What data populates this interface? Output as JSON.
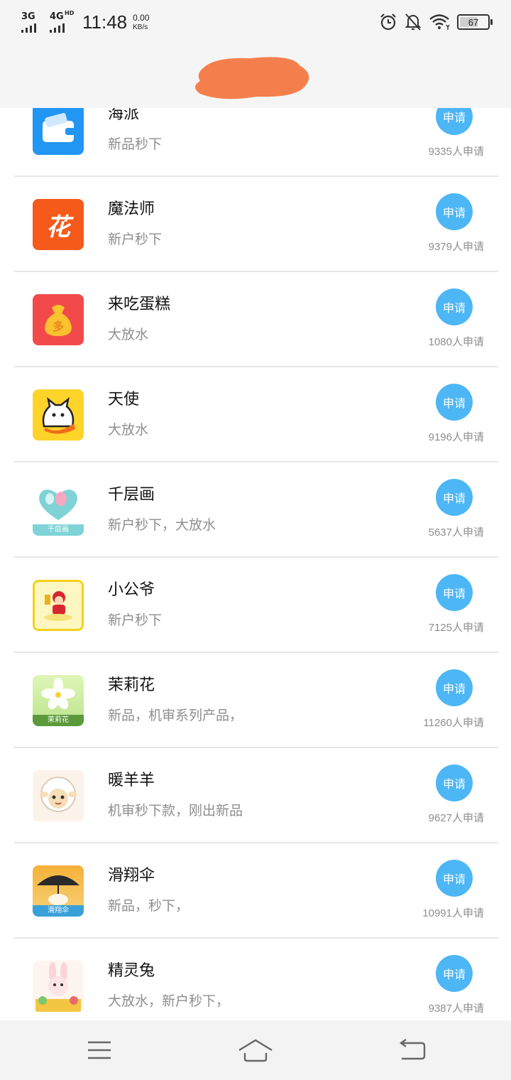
{
  "status_bar": {
    "net1": "3G",
    "net2": "4G",
    "net2_sup": "HD",
    "time": "11:48",
    "speed_value": "0.00",
    "speed_unit": "KB/s",
    "battery": "67",
    "battery_level": 0.67,
    "icons": [
      "alarm-icon",
      "bell-muted-icon",
      "wifi-icon",
      "battery-icon"
    ]
  },
  "apply_color": "#4db6f5",
  "apps": [
    {
      "name": "海派",
      "desc": "新品秒下",
      "button": "申请",
      "count": "9335人申请",
      "icon": "wallet-icon"
    },
    {
      "name": "魔法师",
      "desc": "新户秒下",
      "button": "申请",
      "count": "9379人申请",
      "icon": "flower-logo-icon"
    },
    {
      "name": "来吃蛋糕",
      "desc": "大放水",
      "button": "申请",
      "count": "1080人申请",
      "icon": "money-bag-icon"
    },
    {
      "name": "天使",
      "desc": "大放水",
      "button": "申请",
      "count": "9196人申请",
      "icon": "fox-icon"
    },
    {
      "name": "千层画",
      "desc": "新户秒下，大放水",
      "button": "申请",
      "count": "5637人申请",
      "icon": "heart-balloon-icon",
      "icon_text": "千层画"
    },
    {
      "name": "小公爷",
      "desc": "新户秒下",
      "button": "申请",
      "count": "7125人申请",
      "icon": "god-of-wealth-icon"
    },
    {
      "name": "茉莉花",
      "desc": "新品，机审系列产品，",
      "button": "申请",
      "count": "11260人申请",
      "icon": "jasmine-flower-icon",
      "icon_text": "茉莉花"
    },
    {
      "name": "暖羊羊",
      "desc": "机审秒下款，刚出新品",
      "button": "申请",
      "count": "9627人申请",
      "icon": "sheep-icon"
    },
    {
      "name": "滑翔伞",
      "desc": "新品，秒下，",
      "button": "申请",
      "count": "10991人申请",
      "icon": "parasol-icon",
      "icon_text": "滑翔伞"
    },
    {
      "name": "精灵兔",
      "desc": "大放水，新户秒下，",
      "button": "申请",
      "count": "9387人申请",
      "icon": "bunny-icon"
    }
  ],
  "nav": [
    "menu-icon",
    "home-icon",
    "back-icon"
  ]
}
